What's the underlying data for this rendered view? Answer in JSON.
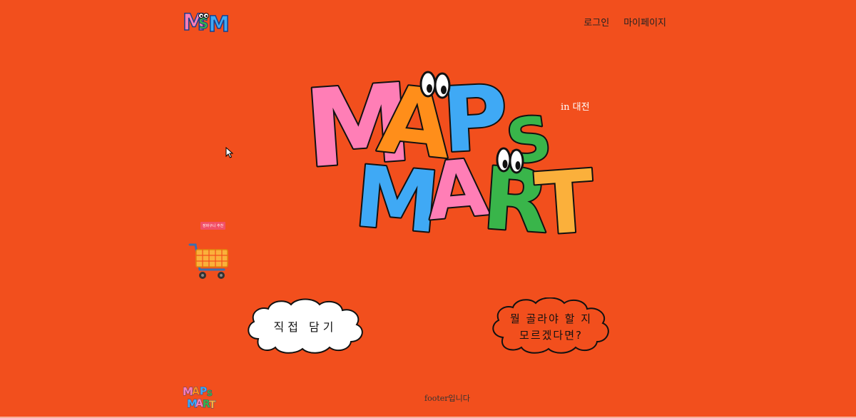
{
  "header": {
    "logo_alt": "MSM",
    "nav": {
      "login_label": "로그인",
      "mypage_label": "마이페이지"
    }
  },
  "hero": {
    "logo_line1": "MAPS",
    "logo_line2": "MART",
    "location_label": "in 대전"
  },
  "cart": {
    "badge_label": "장바구니 추천"
  },
  "actions": {
    "direct_label": "직접 담기",
    "recommend_line1": "뭘 골라야 할 지",
    "recommend_line2": "모르겠다면?"
  },
  "footer": {
    "logo_alt": "MAPS MART",
    "text": "footer입니다"
  },
  "colors": {
    "background": "#f24f1d",
    "pink": "#ff7eb6",
    "orange": "#ff8e1a",
    "blue": "#3fa9f5",
    "green": "#39b54a",
    "yellow": "#fbb03b"
  }
}
